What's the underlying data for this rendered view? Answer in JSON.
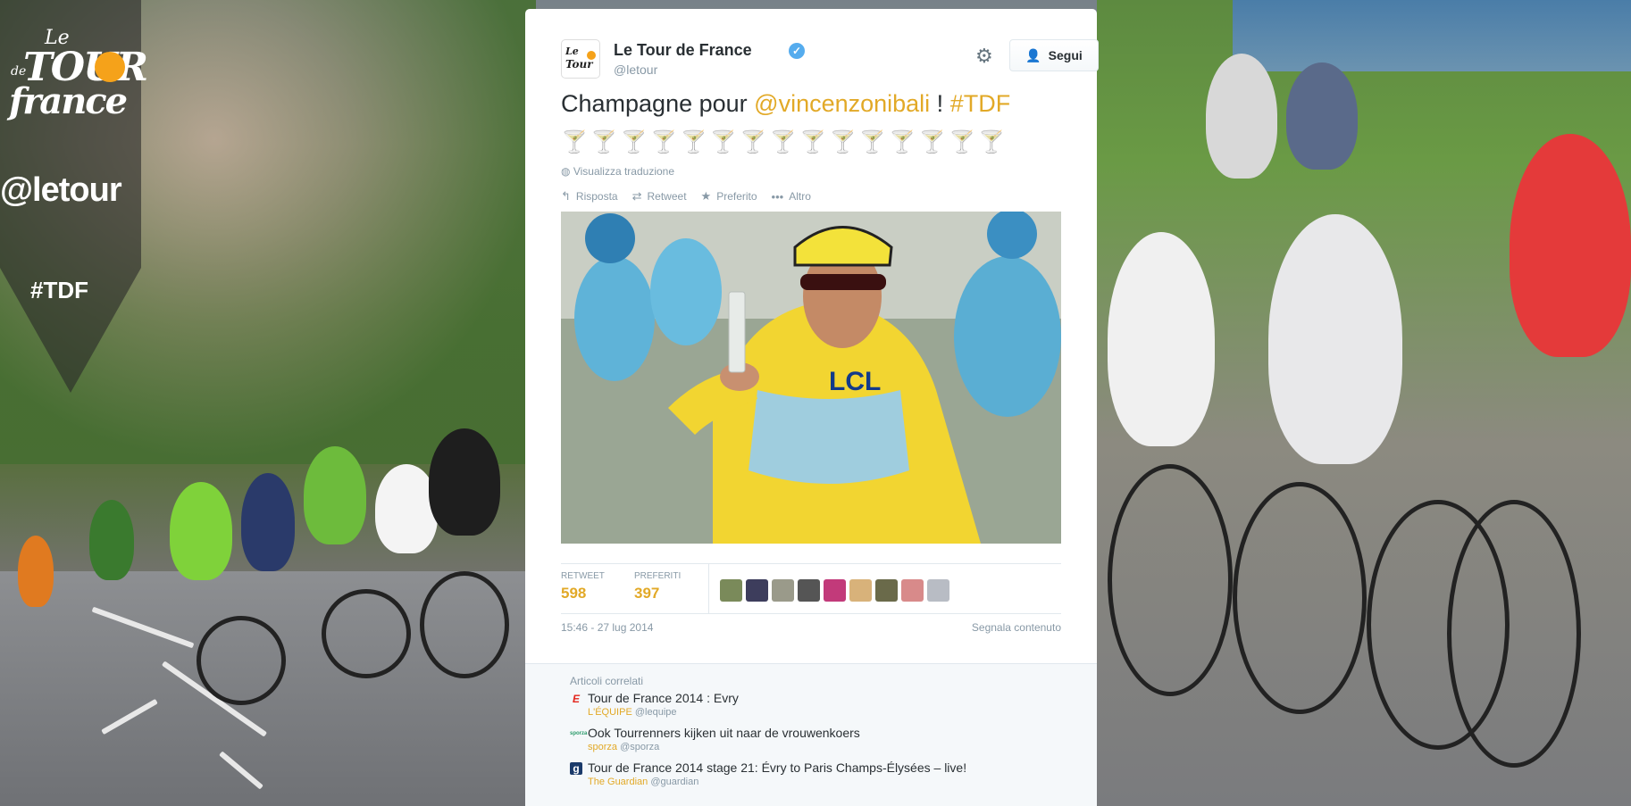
{
  "brand": {
    "logo_le": "Le",
    "logo_de": "de",
    "logo_tour": "TOUR",
    "logo_france": "france",
    "handle": "@letour",
    "hashtag": "#TDF"
  },
  "tweet": {
    "author_name": "Le Tour de France",
    "author_handle": "@letour",
    "verified_mark": "✓",
    "follow_label": "Segui",
    "text_prefix": "Champagne pour ",
    "mention": "@vincenzonibali",
    "text_mid": " ! ",
    "hashtag": "#TDF",
    "emoji_line": "🍸🍸🍸🍸🍸🍸🍸🍸🍸🍸🍸🍸🍸🍸🍸",
    "translate_label": "Visualizza traduzione",
    "actions": {
      "reply": "Risposta",
      "retweet": "Retweet",
      "favorite": "Preferito",
      "more": "Altro"
    },
    "stats": {
      "retweets_label": "RETWEET",
      "retweets_value": "598",
      "favorites_label": "PREFERITI",
      "favorites_value": "397"
    },
    "timestamp": "15:46 - 27 lug 2014",
    "report_label": "Segnala contenuto"
  },
  "related": {
    "title": "Articoli correlati",
    "items": [
      {
        "icon": "E",
        "headline": "Tour de France 2014 : Evry",
        "source": "L'ÉQUIPE",
        "handle": "@lequipe"
      },
      {
        "icon": "sporza",
        "headline": "Ook Tourrenners kijken uit naar de vrouwenkoers",
        "source": "sporza",
        "handle": "@sporza"
      },
      {
        "icon": "g",
        "headline": "Tour de France 2014 stage 21: Évry to Paris Champs-Élysées – live!",
        "source": "The Guardian",
        "handle": "@guardian"
      }
    ]
  },
  "colors": {
    "accent": "#e2a927",
    "muted": "#8899a6",
    "text": "#292f33",
    "verified": "#55acee"
  }
}
